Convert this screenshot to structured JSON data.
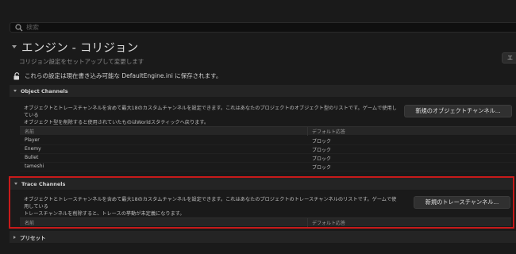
{
  "search": {
    "placeholder": "検索"
  },
  "page": {
    "title": "エンジン - コリジョン",
    "subtitle": "コリジョン設定をセットアップして変更します",
    "right_button_label": "エ"
  },
  "notice": {
    "text": "これらの設定は現在書き込み可能な DefaultEngine.ini に保存されます。"
  },
  "object_channels": {
    "title": "Object Channels",
    "description_line1": "オブジェクトとトレースチャンネルを含めて最大18のカスタムチャンネルを設定できます。これはあなたのプロジェクトのオブジェクト型のリストです。ゲームで使用している",
    "description_line2": "オブジェクト型を削除すると使用されていたものはWorldスタティックへ戻ります。",
    "new_button": "新規のオブジェクトチャンネル...",
    "columns": {
      "name": "名前",
      "response": "デフォルト応答"
    },
    "rows": [
      {
        "name": "Player",
        "response": "ブロック"
      },
      {
        "name": "Enemy",
        "response": "ブロック"
      },
      {
        "name": "Bullet",
        "response": "ブロック"
      },
      {
        "name": "tameshi",
        "response": "ブロック"
      }
    ]
  },
  "trace_channels": {
    "title": "Trace Channels",
    "description_line1": "オブジェクトとトレースチャンネルを含めて最大18のカスタムチャンネルを設定できます。これはあなたのプロジェクトのトレースチャンネルのリストです。ゲームで使用している",
    "description_line2": "トレースチャンネルを削除すると、トレースの挙動が未定義になります。",
    "new_button": "新規のトレースチャンネル...",
    "columns": {
      "name": "名前",
      "response": "デフォルト応答"
    }
  },
  "presets": {
    "title": "プリセット"
  },
  "colors": {
    "highlight": "#c81a1a",
    "background": "#1a1a1a"
  },
  "icons": {
    "search": "search-icon",
    "lock": "unlock-icon"
  }
}
